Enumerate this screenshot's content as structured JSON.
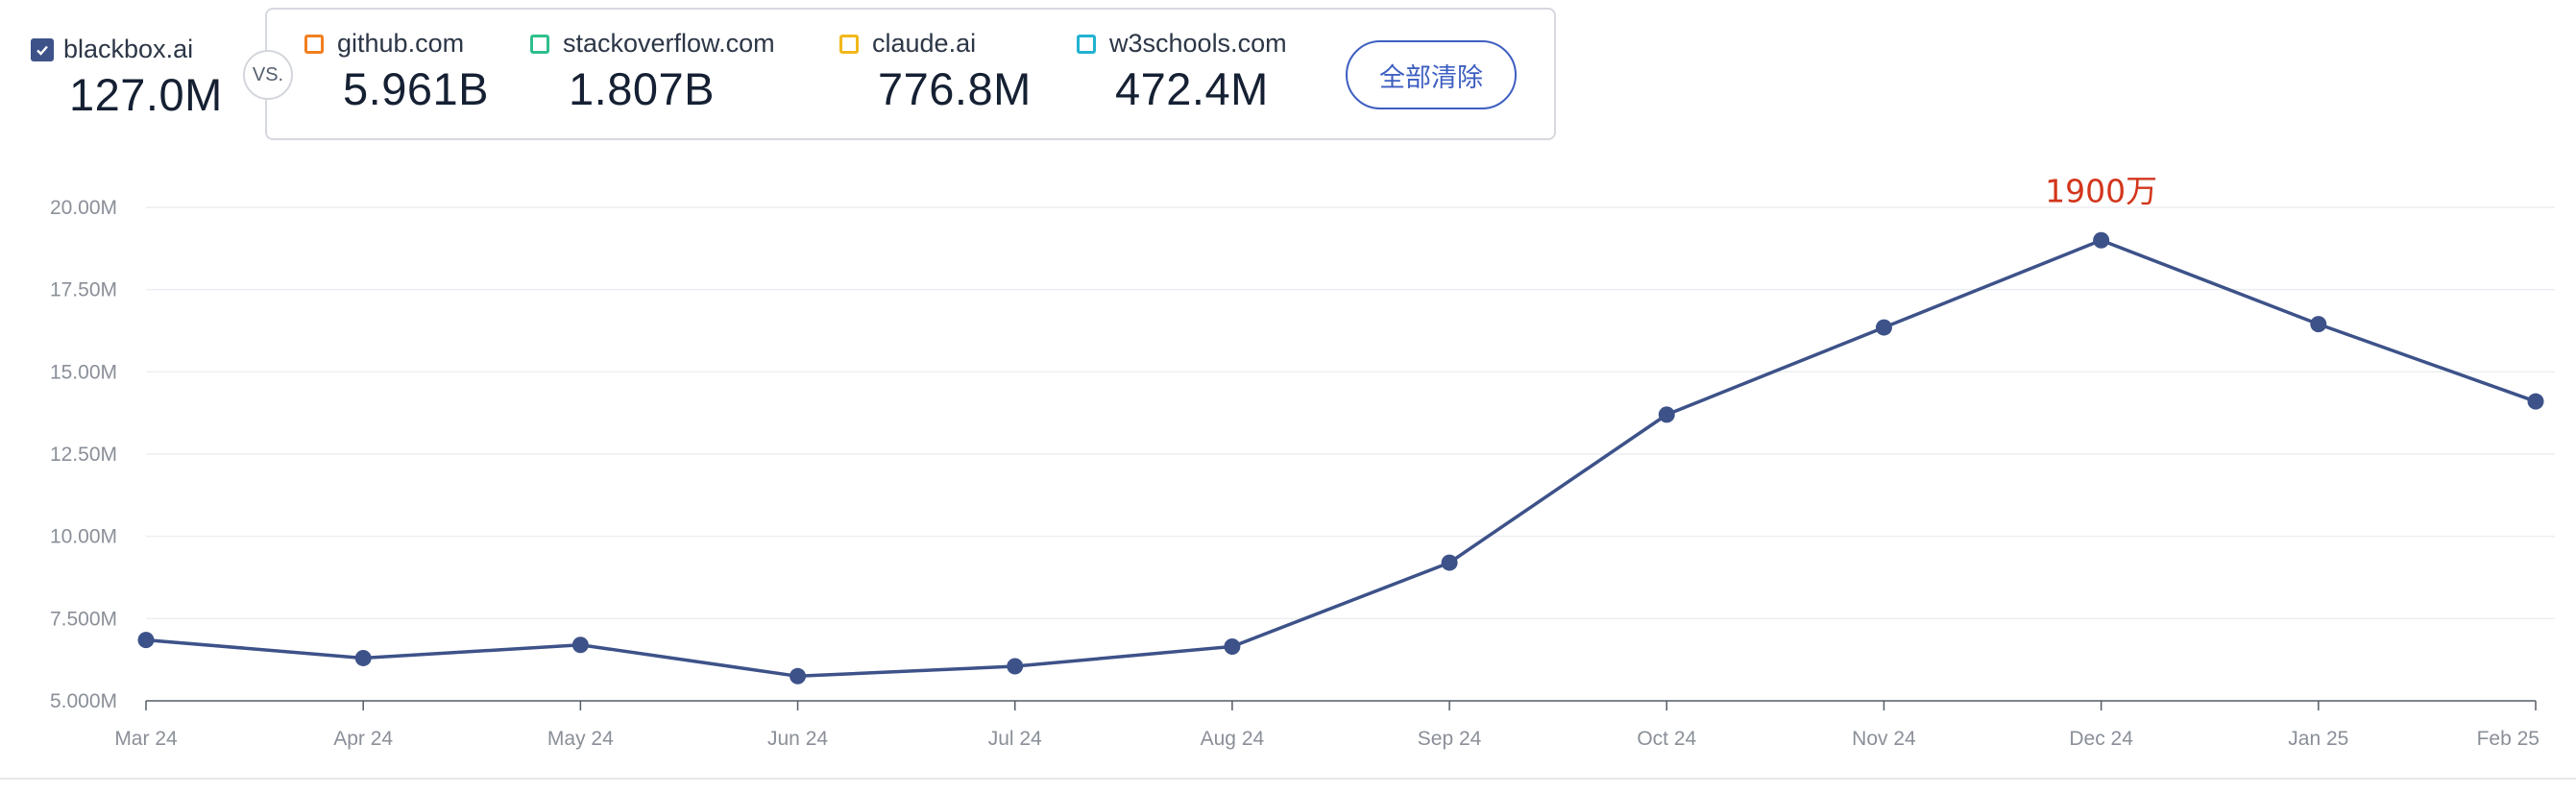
{
  "primary": {
    "name": "blackbox.ai",
    "value": "127.0M",
    "checked": true,
    "color": "#3d5289"
  },
  "vs_label": "VS.",
  "comparisons": [
    {
      "name": "github.com",
      "value": "5.961B",
      "color": "#f07f1f"
    },
    {
      "name": "stackoverflow.com",
      "value": "1.807B",
      "color": "#2fbf8c"
    },
    {
      "name": "claude.ai",
      "value": "776.8M",
      "color": "#f2b81b"
    },
    {
      "name": "w3schools.com",
      "value": "472.4M",
      "color": "#22b2d0"
    }
  ],
  "clear_all_label": "全部清除",
  "chart_data": {
    "type": "line",
    "categories": [
      "Mar 24",
      "Apr 24",
      "May 24",
      "Jun 24",
      "Jul 24",
      "Aug 24",
      "Sep 24",
      "Oct 24",
      "Nov 24",
      "Dec 24",
      "Jan 25",
      "Feb 25"
    ],
    "series": [
      {
        "name": "blackbox.ai",
        "color": "#3d5289",
        "values": [
          6.85,
          6.3,
          6.7,
          5.75,
          6.05,
          6.65,
          9.2,
          13.7,
          16.35,
          19.0,
          16.45,
          14.1
        ]
      }
    ],
    "yunit": "M",
    "ylim": [
      5.0,
      20.0
    ],
    "yticks": [
      "5.000M",
      "7.500M",
      "10.00M",
      "12.50M",
      "15.00M",
      "17.50M",
      "20.00M"
    ],
    "ytick_values": [
      5,
      7.5,
      10,
      12.5,
      15,
      17.5,
      20
    ],
    "annotation": {
      "category": "Dec 24",
      "text": "1900万",
      "color": "#d2361c"
    },
    "grid": true
  }
}
